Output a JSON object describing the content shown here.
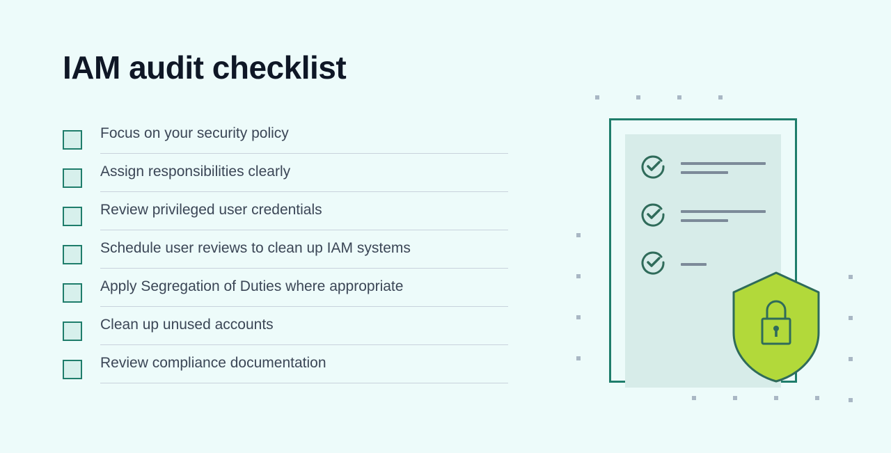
{
  "title": "IAM audit checklist",
  "checklist": {
    "items": [
      {
        "label": "Focus on your security policy"
      },
      {
        "label": "Assign responsibilities clearly"
      },
      {
        "label": "Review privileged user credentials"
      },
      {
        "label": "Schedule user reviews to clean up IAM systems"
      },
      {
        "label": "Apply Segregation of Duties where appropriate"
      },
      {
        "label": "Clean up unused accounts"
      },
      {
        "label": "Review compliance documentation"
      }
    ]
  },
  "colors": {
    "background": "#edfbfa",
    "checkbox_border": "#1f7d6b",
    "checkbox_fill": "#d7f0ec",
    "text_title": "#0f1726",
    "text_body": "#3b4656",
    "divider": "#c8d2dc",
    "accent_shield": "#b2d93a",
    "accent_shield_stroke": "#2f6b5a",
    "doc_line": "#7c8a99"
  },
  "illustration": {
    "type": "checklist-document-with-shield",
    "doc_rows": 3,
    "shield_icon": "lock"
  }
}
